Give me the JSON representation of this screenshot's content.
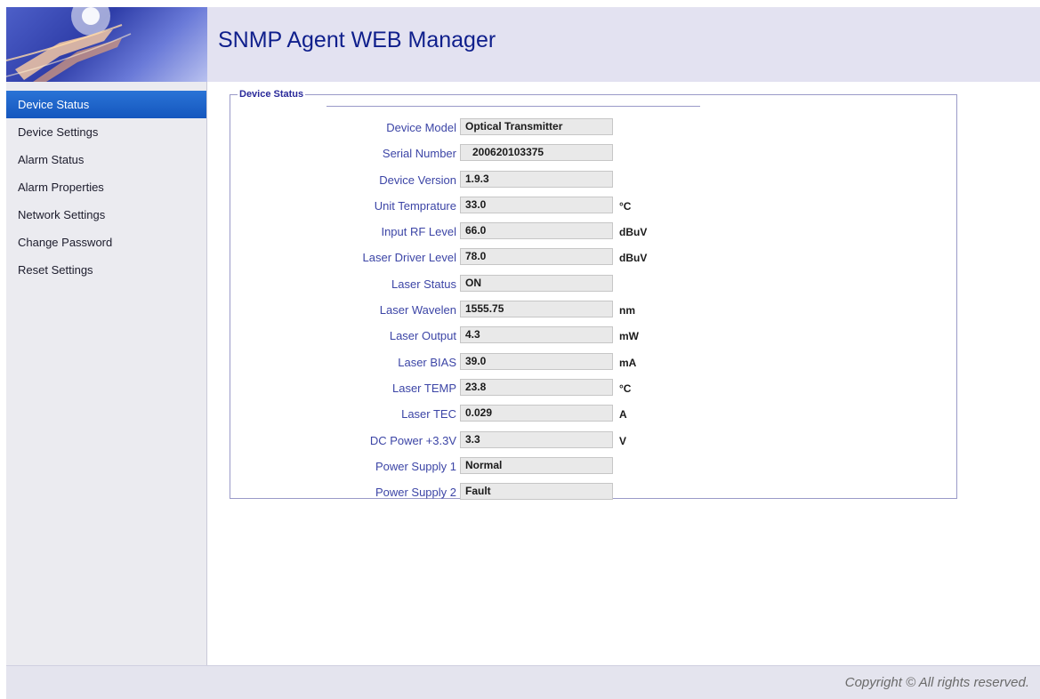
{
  "header": {
    "title": "SNMP Agent WEB Manager"
  },
  "sidebar": {
    "items": [
      {
        "label": "Device Status",
        "active": true
      },
      {
        "label": "Device Settings"
      },
      {
        "label": "Alarm Status"
      },
      {
        "label": "Alarm Properties"
      },
      {
        "label": "Network Settings"
      },
      {
        "label": "Change Password"
      },
      {
        "label": "Reset Settings"
      }
    ]
  },
  "panel": {
    "legend": "Device Status",
    "rows": [
      {
        "label": "Device Model",
        "value": "Optical Transmitter",
        "unit": ""
      },
      {
        "label": "Serial Number",
        "value": "200620103375",
        "unit": ""
      },
      {
        "label": "Device Version",
        "value": "1.9.3",
        "unit": ""
      },
      {
        "label": "Unit Temprature",
        "value": "33.0",
        "unit": "°C"
      },
      {
        "label": "Input RF Level",
        "value": "66.0",
        "unit": "dBuV"
      },
      {
        "label": "Laser Driver Level",
        "value": "78.0",
        "unit": "dBuV"
      },
      {
        "label": "Laser Status",
        "value": "ON",
        "unit": ""
      },
      {
        "label": "Laser Wavelen",
        "value": "1555.75",
        "unit": "nm"
      },
      {
        "label": "Laser Output",
        "value": "4.3",
        "unit": "mW"
      },
      {
        "label": "Laser BIAS",
        "value": "39.0",
        "unit": "mA"
      },
      {
        "label": "Laser TEMP",
        "value": "23.8",
        "unit": "°C"
      },
      {
        "label": "Laser TEC",
        "value": "0.029",
        "unit": "A"
      },
      {
        "label": "DC Power +3.3V",
        "value": "3.3",
        "unit": "V"
      },
      {
        "label": "Power Supply 1",
        "value": "Normal",
        "unit": ""
      },
      {
        "label": "Power Supply 2",
        "value": "Fault",
        "unit": ""
      }
    ]
  },
  "footer": {
    "copyright": "Copyright © All rights reserved."
  },
  "colors": {
    "accent": "#1557be",
    "title": "#0f1f8c",
    "label": "#3c45a6"
  }
}
